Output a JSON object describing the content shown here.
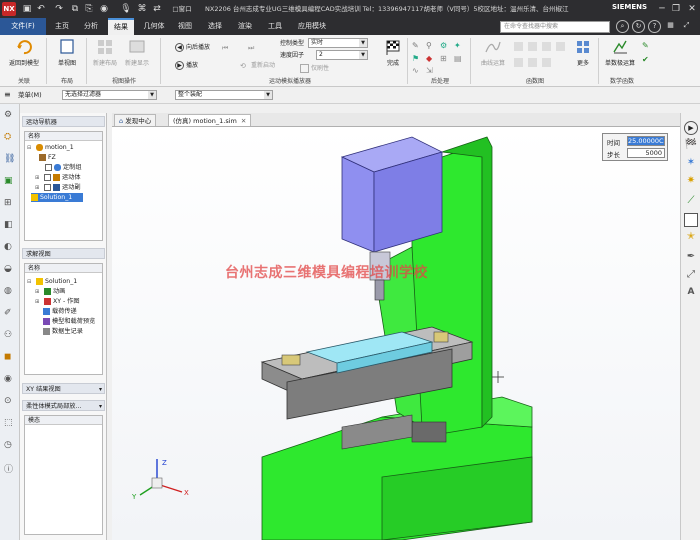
{
  "titlebar": {
    "title": "NX2206 台州志成专业UG三维模具编程CAD实战培训  Tel：13396947117胡老师（V同号）5校区地址：温州乐清、台州椒江",
    "brand": "SIEMENS",
    "quick_icons": [
      "save-icon",
      "undo-icon",
      "redo-icon",
      "copy-icon",
      "paste-icon",
      "mic-icon",
      "command-icon",
      "window-icon"
    ],
    "window_menu_label": "窗口"
  },
  "menubar": {
    "file_label": "文件(F)",
    "tabs": [
      "主页",
      "分析",
      "结果",
      "几何体",
      "视图",
      "选择",
      "渲染",
      "工具",
      "应用模块"
    ],
    "active_tab": "结果",
    "search_placeholder": "在命令查找器中搜索"
  },
  "ribbon": {
    "groups": [
      {
        "label": "关联",
        "items": [
          "返回到模型"
        ]
      },
      {
        "label": "布局",
        "items": [
          "单视图"
        ]
      },
      {
        "label": "视图操作",
        "items": [
          "新建布局",
          "新建显示"
        ]
      },
      {
        "label": "运动模拟播放器",
        "items": [
          "向后播放",
          "播放",
          "重新启动",
          "控制类型",
          "速度因子",
          "仅刷性",
          "完成"
        ]
      },
      {
        "label": "后处理",
        "items": []
      },
      {
        "label": "函数图",
        "items": [
          "曲线运算",
          "更多"
        ]
      },
      {
        "label": "数学函数",
        "items": [
          "单数极运算"
        ]
      }
    ],
    "control_type_label": "控制类型",
    "control_type_value": "实时",
    "speed_label": "速度因子",
    "speed_value": "2",
    "refresh_label": "仅刷性",
    "finish_label": "完成",
    "back_play_label": "向后播放",
    "play_label": "播放",
    "restart_label": "重新启动",
    "return_label": "返回到模型",
    "single_view_label": "单视图",
    "new_layout_label": "新建布局",
    "new_display_label": "新建显示",
    "curve_op_label": "曲线运算",
    "more_label": "更多",
    "single_math_label": "单数极运算"
  },
  "filterbar": {
    "menu_label": "菜单(M)",
    "filter_value": "无选择过滤器",
    "assembly_value": "整个装配"
  },
  "nav": {
    "title": "运动导航器",
    "column": "名称",
    "tree": [
      {
        "label": "motion_1",
        "indent": 0,
        "selected": false
      },
      {
        "label": "FZ",
        "indent": 1,
        "selected": false
      },
      {
        "label": "定制组",
        "indent": 2,
        "selected": false
      },
      {
        "label": "运动体",
        "indent": 1,
        "selected": false
      },
      {
        "label": "运动副",
        "indent": 1,
        "selected": false
      },
      {
        "label": "Solution_1",
        "indent": 0,
        "selected": true
      }
    ],
    "solve_title": "求解视图",
    "solve_column": "名称",
    "solve_tree": [
      {
        "label": "Solution_1",
        "indent": 0
      },
      {
        "label": "动画",
        "indent": 1
      },
      {
        "label": "XY - 作图",
        "indent": 1
      },
      {
        "label": "载荷传递",
        "indent": 1
      },
      {
        "label": "模型和载荷预览",
        "indent": 1
      },
      {
        "label": "数据生记录",
        "indent": 1
      }
    ],
    "xy_title": "XY 结果视图",
    "flex_title": "柔性体模式局部放...",
    "mode_column": "模态"
  },
  "doctabs": [
    {
      "label": "发现中心",
      "active": false
    },
    {
      "label": "(仿真) motion_1.sim",
      "active": true
    }
  ],
  "time_panel": {
    "time_label": "时间",
    "time_value": "25.00000C",
    "step_label": "步长",
    "step_value": "5000"
  },
  "watermark": "台州志成三维模具编程培训学校",
  "colors": {
    "accent": "#2b5797",
    "machine_green": "#2ee82e",
    "head_purple": "#8f8ff0",
    "table_blue": "#8fe0f0",
    "slide_gray": "#9a9a9a"
  }
}
